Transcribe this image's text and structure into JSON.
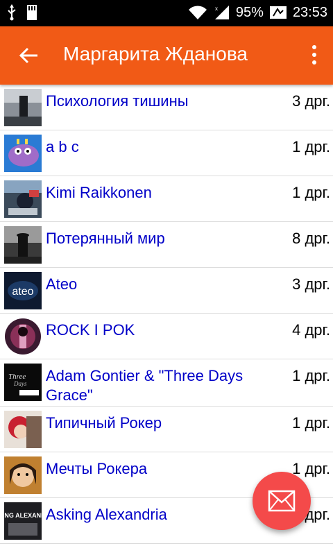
{
  "status_bar": {
    "battery": "95%",
    "time": "23:53"
  },
  "app_bar": {
    "title": "Маргарита Жданова"
  },
  "groups": [
    {
      "title": "Психология тишины",
      "count": "3 дрг."
    },
    {
      "title": "a b c",
      "count": "1 дрг."
    },
    {
      "title": "Kimi Raikkonen",
      "count": "1 дрг."
    },
    {
      "title": "Потерянный мир",
      "count": "8 дрг."
    },
    {
      "title": "Ateo",
      "count": "3 дрг.",
      "thumb_text": "ateo"
    },
    {
      "title": "ROCK I POK",
      "count": "4 дрг."
    },
    {
      "title": "Adam Gontier & \"Three Days Grace\"",
      "count": "1 дрг."
    },
    {
      "title": "Типичный Рокер",
      "count": "1 дрг."
    },
    {
      "title": "Мечты Рокера",
      "count": "1 дрг."
    },
    {
      "title": "Asking Alexandria",
      "count": "2 дрг.",
      "thumb_text": "ASKING ALEXANDRIA"
    }
  ],
  "colors": {
    "app_bar": "#f15a16",
    "link": "#0000c8",
    "fab": "#f44a4a"
  },
  "icons": {
    "back": "arrow-left-icon",
    "menu": "more-vert-icon",
    "fab": "envelope-icon"
  }
}
